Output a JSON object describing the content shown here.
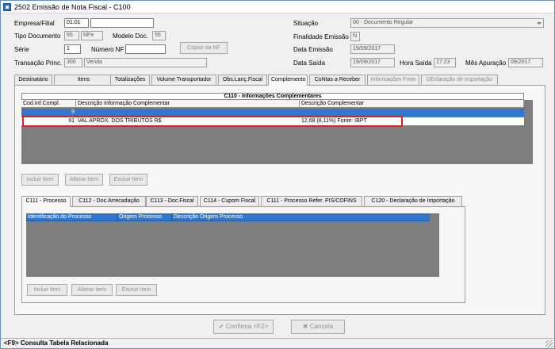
{
  "window": {
    "title": "2502 Emissão de Nota Fiscal  - C100"
  },
  "header": {
    "empresa": {
      "label": "Empresa/Filial",
      "code": "01.01",
      "name": ""
    },
    "tipo_documento": {
      "label": "Tipo Documento",
      "code": "55",
      "value": "NFe"
    },
    "modelo_doc": {
      "label": "Modelo Doc.",
      "value": "55"
    },
    "serie": {
      "label": "Série",
      "value": "1"
    },
    "numero_nf": {
      "label": "Número NF",
      "value": ""
    },
    "copiar_nf": {
      "label": "Copiar da NF"
    },
    "transacao": {
      "label": "Transação Princ.",
      "code": "300",
      "value": "Venda"
    },
    "situacao": {
      "label": "Situação",
      "value": "00 - Documento Regular"
    },
    "finalidade": {
      "label": "Finalidade Emissão",
      "value": "N"
    },
    "data_emissao": {
      "label": "Data Emissão",
      "value": "19/09/2017"
    },
    "data_saida": {
      "label": "Data Saída",
      "value": "19/09/2017"
    },
    "hora_saida": {
      "label": "Hora Saída",
      "value": "17:23"
    },
    "mes_apuracao": {
      "label": "Mês Apuração",
      "value": "09/2017"
    }
  },
  "main_tabs": [
    {
      "label": "Destinatário"
    },
    {
      "label": "Itens"
    },
    {
      "label": "Totalizações"
    },
    {
      "label": "Volume Transportador"
    },
    {
      "label": "Obs.Lanç.Fiscal"
    },
    {
      "label": "Complemento"
    },
    {
      "label": "CoNtas a Receber"
    },
    {
      "label": "Informações Frete"
    },
    {
      "label": "DEclaração de Importação"
    }
  ],
  "c110": {
    "title": "C110 - Informações Complementares",
    "columns": [
      "Cod.Inf.Compl.",
      "Descrição Informação Complementar",
      "Descrição Complementar"
    ],
    "rows": [
      {
        "code": "9",
        "descricao": "",
        "complementar": ""
      },
      {
        "code": "91",
        "descricao": "VAL APROX. DOS TRIBUTOS R$",
        "complementar": "12,68 (8,11%) Fonte: IBPT"
      }
    ],
    "buttons": {
      "incluir": "Incluir Item",
      "alterar": "Alterar Item",
      "excluir": "Excluir Item"
    }
  },
  "sub_tabs": [
    {
      "label": "C111 - Processo"
    },
    {
      "label": "C112 - Doc.Arrecadação"
    },
    {
      "label": "C113 - Doc.Fiscal"
    },
    {
      "label": "C114 - Cupom Fiscal"
    },
    {
      "label": "C111 - Processo Refer. PIS/COFINS"
    },
    {
      "label": "C120 - Declaração de Importação"
    }
  ],
  "c111": {
    "columns": [
      "Identificação do Processo",
      "Origem Processo",
      "Descrição Origem Processo"
    ],
    "buttons": {
      "incluir": "Incluir Item",
      "alterar": "Alterar Item",
      "excluir": "Excluir Item"
    }
  },
  "footer": {
    "confirma": "Confirma <F2>",
    "cancela": "Cancela"
  },
  "status": {
    "text": "<F9> Consulta Tabela Relacionada"
  },
  "colors": {
    "selection": "#2f78d0",
    "highlight_box": "#e02020",
    "grid_bg": "#7d7d7d"
  }
}
